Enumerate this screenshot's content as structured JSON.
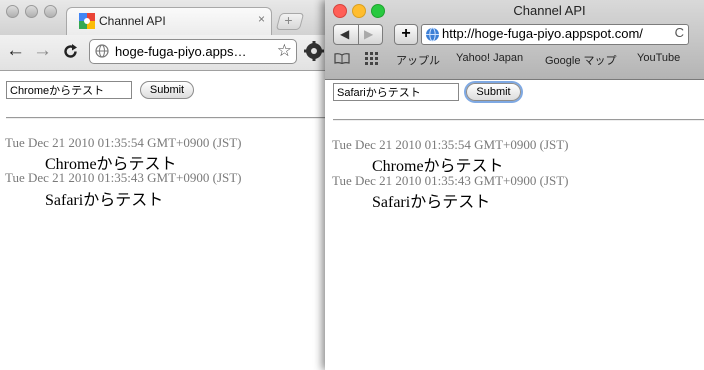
{
  "chrome": {
    "tab_title": "Channel API",
    "tab_close": "×",
    "new_tab": "+",
    "back": "←",
    "forward": "→",
    "reload": "C",
    "url": "hoge-fuga-piyo.apps…",
    "star": "☆",
    "page": {
      "input_value": "Chromeからテスト",
      "submit_label": "Submit",
      "messages": [
        {
          "timestamp": "Tue Dec 21 2010 01:35:54 GMT+0900 (JST)",
          "text": "Chromeからテスト"
        },
        {
          "timestamp": "Tue Dec 21 2010 01:35:43 GMT+0900 (JST)",
          "text": "Safariからテスト"
        }
      ]
    }
  },
  "safari": {
    "window_title": "Channel API",
    "back": "◀",
    "forward": "▶",
    "add": "+",
    "url": "http://hoge-fuga-piyo.appspot.com/",
    "reload": "C",
    "bookmarks": [
      "アップル",
      "Yahoo! Japan",
      "Google マップ",
      "YouTube"
    ],
    "page": {
      "input_value": "Safariからテスト",
      "submit_label": "Submit",
      "messages": [
        {
          "timestamp": "Tue Dec 21 2010 01:35:54 GMT+0900 (JST)",
          "text": "Chromeからテスト"
        },
        {
          "timestamp": "Tue Dec 21 2010 01:35:43 GMT+0900 (JST)",
          "text": "Safariからテスト"
        }
      ]
    }
  },
  "colors": {
    "safari_close": "#ff5f57",
    "safari_minimize": "#ffbd2e",
    "safari_zoom": "#28c940",
    "timestamp": "#7a7a7a"
  }
}
